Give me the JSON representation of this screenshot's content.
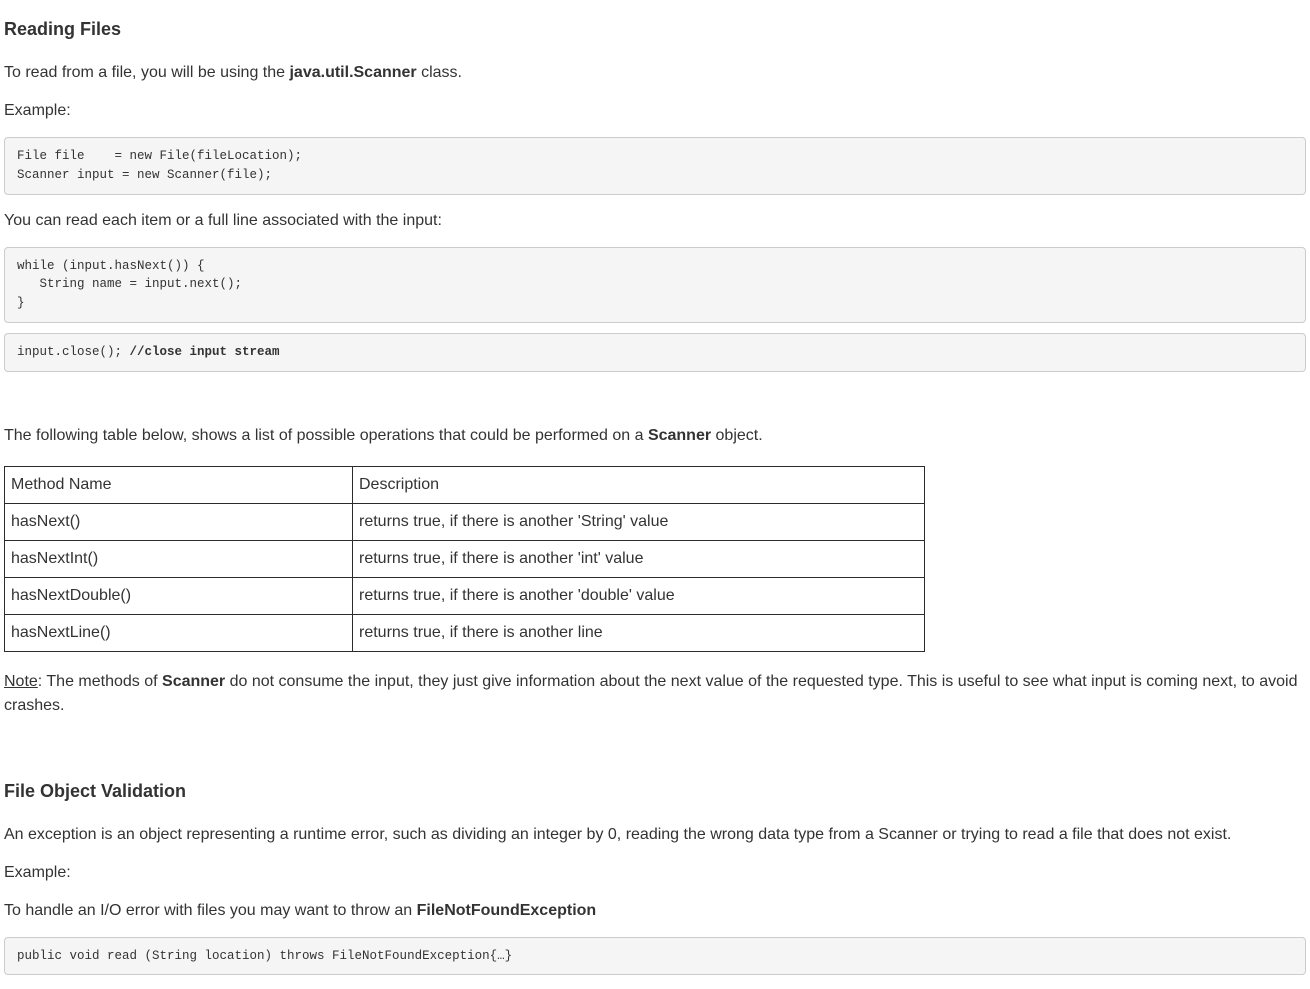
{
  "section1": {
    "heading": "Reading Files",
    "intro_pre": "To read from a file, you will be using the ",
    "intro_bold": "java.util.Scanner",
    "intro_post": " class.",
    "example_label": "Example:",
    "code1": "File file    = new File(fileLocation);\nScanner input = new Scanner(file);",
    "mid_text": "You can read each item or a full line associated with the input:",
    "code2": "while (input.hasNext()) {\n   String name = input.next();\n}",
    "code3_pre": "input.close(); ",
    "code3_bold": "//close input stream",
    "table_intro_pre": "The following table below, shows a list of possible operations that could be performed on a ",
    "table_intro_bold": "Scanner",
    "table_intro_post": " object.",
    "table": {
      "header_method": "Method Name",
      "header_desc": "Description",
      "rows": [
        {
          "method": "hasNext()",
          "desc": "returns true, if there is another 'String' value"
        },
        {
          "method": "hasNextInt()",
          "desc": "returns true, if there is another 'int' value"
        },
        {
          "method": "hasNextDouble()",
          "desc": "returns true, if there is another 'double' value"
        },
        {
          "method": "hasNextLine()",
          "desc": "returns true, if there is another line"
        }
      ]
    },
    "note_label": "Note",
    "note_pre": ": The methods of  ",
    "note_bold": "Scanner",
    "note_post": " do not consume the input, they just give information about the next value of the requested type. This is useful to see what input is coming next, to avoid crashes."
  },
  "section2": {
    "heading": "File Object Validation",
    "intro": "An exception is an object representing a runtime error, such as dividing an integer by 0, reading the wrong data type from a Scanner or trying to read a file that does not exist.",
    "example_label": "Example:",
    "handle_pre": "To handle an I/O error with files you may want to throw an ",
    "handle_bold": "FileNotFoundException",
    "code": "public void read (String location) throws FileNotFoundException{…}"
  }
}
